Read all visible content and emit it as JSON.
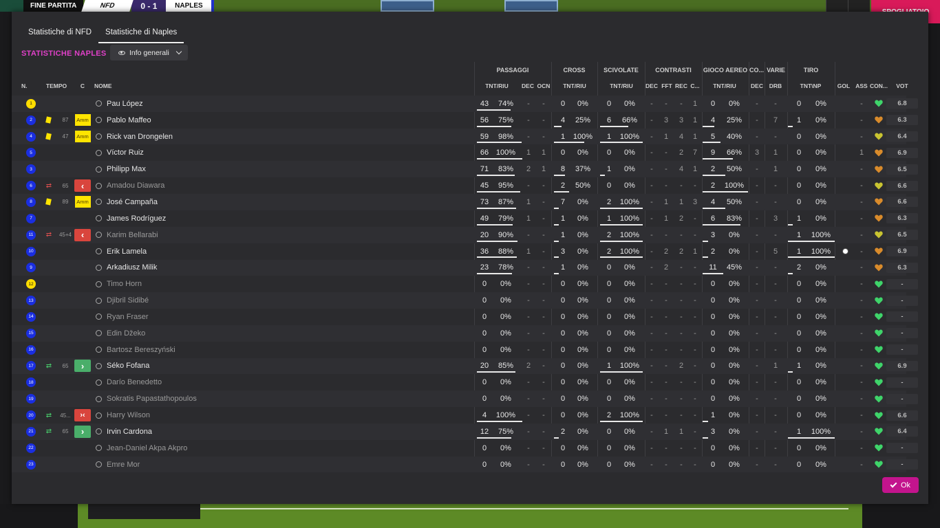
{
  "scorebar": {
    "label": "FINE PARTITA",
    "home": "NFD",
    "score": "0 - 1",
    "away": "NAPLES",
    "right": "SPOGLIATOIO"
  },
  "tabs": [
    "Statistiche di NFD",
    "Statistiche di Naples"
  ],
  "active_tab": 1,
  "section_title": "STATISTICHE NAPLES",
  "view_dropdown": {
    "selected": "Info generali"
  },
  "group_headers": {
    "passaggi": "PASSAGGI",
    "cross": "CROSS",
    "scivolate": "SCIVOLATE",
    "contrasti": "CONTRASTI",
    "gioco_aereo": "GIOCO AEREO",
    "co": "CO...",
    "varie": "VARIE",
    "tiro": "TIRO"
  },
  "col_headers": {
    "n": "N.",
    "tempo": "TEMPO",
    "c": "C",
    "nome": "NOME",
    "pass_tnt": "TNT/RIU",
    "pass_dec": "DEC",
    "pass_ocn": "OCN",
    "cross_tnt": "TNT/RIU",
    "sciv_tnt": "TNT/RIU",
    "con_dec": "DEC",
    "con_fft": "FFT",
    "con_rec": "REC",
    "con_c": "C...",
    "aer_tnt": "TNT/RIU",
    "co_dec": "DEC",
    "var_drb": "DRB",
    "tiro_tnt": "TNT\\NP",
    "gol": "GOL",
    "ass": "ASS",
    "con2": "CON...",
    "vot": "VOT"
  },
  "colors": {
    "accent": "#e040c8",
    "ok_button": "#c3148d",
    "yellow_card": "#ffe400",
    "sub_out": "#d9453d",
    "sub_in": "#4aae6a",
    "heart_green": "#3fd46a",
    "heart_orange": "#d98b2b",
    "heart_yellow": "#c9c431"
  },
  "players": [
    {
      "n": "1",
      "gk": true,
      "card": "",
      "time": "",
      "amm": "",
      "sub": "",
      "arrow": "",
      "name": "Pau López",
      "active": true,
      "pt": "43",
      "pp": "74%",
      "pd": "-",
      "po": "-",
      "ct": "0",
      "cp": "0%",
      "st": "0",
      "sp": "0%",
      "dd": "-",
      "df": "-",
      "dr": "-",
      "dc": "1",
      "at": "0",
      "ap": "0%",
      "cd": "-",
      "drb": "-",
      "tt": "0",
      "tp": "0%",
      "gol": "",
      "ass": "-",
      "heart": "green",
      "vote": "6.8",
      "pbar": 0.74,
      "cbar": 0,
      "sbar": 0,
      "abar": 0,
      "tbar": 0
    },
    {
      "n": "2",
      "gk": false,
      "card": "y",
      "time": "87",
      "amm": "Amm",
      "sub": "",
      "arrow": "",
      "name": "Pablo Maffeo",
      "active": true,
      "pt": "56",
      "pp": "75%",
      "pd": "-",
      "po": "-",
      "ct": "4",
      "cp": "25%",
      "st": "6",
      "sp": "66%",
      "dd": "-",
      "df": "3",
      "dr": "3",
      "dc": "1",
      "at": "4",
      "ap": "25%",
      "cd": "-",
      "drb": "7",
      "tt": "1",
      "tp": "0%",
      "gol": "",
      "ass": "-",
      "heart": "orange",
      "vote": "6.3",
      "pbar": 0.75,
      "cbar": 0.25,
      "sbar": 0.66,
      "abar": 0.25,
      "tbar": 0
    },
    {
      "n": "4",
      "gk": false,
      "card": "y",
      "time": "47",
      "amm": "Amm",
      "sub": "",
      "arrow": "",
      "name": "Rick van Drongelen",
      "active": true,
      "pt": "59",
      "pp": "98%",
      "pd": "-",
      "po": "-",
      "ct": "1",
      "cp": "100%",
      "st": "1",
      "sp": "100%",
      "dd": "-",
      "df": "1",
      "dr": "4",
      "dc": "1",
      "at": "5",
      "ap": "40%",
      "cd": "-",
      "drb": "-",
      "tt": "0",
      "tp": "0%",
      "gol": "",
      "ass": "-",
      "heart": "yellow",
      "vote": "6.4",
      "pbar": 0.98,
      "cbar": 1,
      "sbar": 1,
      "abar": 0.4,
      "tbar": 0
    },
    {
      "n": "5",
      "gk": false,
      "card": "",
      "time": "",
      "amm": "",
      "sub": "",
      "arrow": "",
      "name": "Víctor Ruiz",
      "active": true,
      "pt": "66",
      "pp": "100%",
      "pd": "1",
      "po": "1",
      "ct": "0",
      "cp": "0%",
      "st": "0",
      "sp": "0%",
      "dd": "-",
      "df": "-",
      "dr": "2",
      "dc": "7",
      "at": "9",
      "ap": "66%",
      "cd": "3",
      "drb": "1",
      "tt": "0",
      "tp": "0%",
      "gol": "",
      "ass": "1",
      "heart": "orange",
      "vote": "6.9",
      "pbar": 1,
      "cbar": 0,
      "sbar": 0,
      "abar": 0.66,
      "tbar": 0
    },
    {
      "n": "3",
      "gk": false,
      "card": "",
      "time": "",
      "amm": "",
      "sub": "",
      "arrow": "",
      "name": "Philipp Max",
      "active": true,
      "pt": "71",
      "pp": "83%",
      "pd": "2",
      "po": "1",
      "ct": "8",
      "cp": "37%",
      "st": "1",
      "sp": "0%",
      "dd": "-",
      "df": "-",
      "dr": "4",
      "dc": "1",
      "at": "2",
      "ap": "50%",
      "cd": "-",
      "drb": "1",
      "tt": "0",
      "tp": "0%",
      "gol": "",
      "ass": "-",
      "heart": "orange",
      "vote": "6.5",
      "pbar": 0.83,
      "cbar": 0.37,
      "sbar": 0,
      "abar": 0.5,
      "tbar": 0
    },
    {
      "n": "6",
      "gk": false,
      "card": "",
      "time": "65",
      "amm": "",
      "sub": "red",
      "arrow": "out",
      "name": "Amadou Diawara",
      "active": false,
      "pt": "45",
      "pp": "95%",
      "pd": "-",
      "po": "-",
      "ct": "2",
      "cp": "50%",
      "st": "0",
      "sp": "0%",
      "dd": "-",
      "df": "-",
      "dr": "-",
      "dc": "-",
      "at": "2",
      "ap": "100%",
      "cd": "-",
      "drb": "-",
      "tt": "0",
      "tp": "0%",
      "gol": "",
      "ass": "-",
      "heart": "yellow",
      "vote": "6.6",
      "pbar": 0.95,
      "cbar": 0.5,
      "sbar": 0,
      "abar": 1,
      "tbar": 0
    },
    {
      "n": "8",
      "gk": false,
      "card": "y",
      "time": "89",
      "amm": "Amm",
      "sub": "",
      "arrow": "",
      "name": "José Campaña",
      "active": true,
      "pt": "73",
      "pp": "87%",
      "pd": "1",
      "po": "-",
      "ct": "7",
      "cp": "0%",
      "st": "2",
      "sp": "100%",
      "dd": "-",
      "df": "1",
      "dr": "1",
      "dc": "3",
      "at": "4",
      "ap": "50%",
      "cd": "-",
      "drb": "-",
      "tt": "0",
      "tp": "0%",
      "gol": "",
      "ass": "-",
      "heart": "orange",
      "vote": "6.6",
      "pbar": 0.87,
      "cbar": 0,
      "sbar": 1,
      "abar": 0.5,
      "tbar": 0
    },
    {
      "n": "7",
      "gk": false,
      "card": "",
      "time": "",
      "amm": "",
      "sub": "",
      "arrow": "",
      "name": "James Rodríguez",
      "active": true,
      "pt": "49",
      "pp": "79%",
      "pd": "1",
      "po": "-",
      "ct": "1",
      "cp": "0%",
      "st": "1",
      "sp": "100%",
      "dd": "-",
      "df": "1",
      "dr": "2",
      "dc": "-",
      "at": "6",
      "ap": "83%",
      "cd": "-",
      "drb": "3",
      "tt": "1",
      "tp": "0%",
      "gol": "",
      "ass": "-",
      "heart": "orange",
      "vote": "6.3",
      "pbar": 0.79,
      "cbar": 0,
      "sbar": 1,
      "abar": 0.83,
      "tbar": 0
    },
    {
      "n": "11",
      "gk": false,
      "card": "",
      "time": "45+4",
      "amm": "",
      "sub": "red",
      "arrow": "out",
      "name": "Karim Bellarabi",
      "active": false,
      "pt": "20",
      "pp": "90%",
      "pd": "-",
      "po": "-",
      "ct": "1",
      "cp": "0%",
      "st": "2",
      "sp": "100%",
      "dd": "-",
      "df": "-",
      "dr": "-",
      "dc": "-",
      "at": "3",
      "ap": "0%",
      "cd": "-",
      "drb": "-",
      "tt": "1",
      "tp": "100%",
      "gol": "",
      "ass": "-",
      "heart": "yellow",
      "vote": "6.5",
      "pbar": 0.9,
      "cbar": 0,
      "sbar": 1,
      "abar": 0,
      "tbar": 1
    },
    {
      "n": "10",
      "gk": false,
      "card": "",
      "time": "",
      "amm": "",
      "sub": "",
      "arrow": "",
      "name": "Erik Lamela",
      "active": true,
      "pt": "36",
      "pp": "88%",
      "pd": "1",
      "po": "-",
      "ct": "3",
      "cp": "0%",
      "st": "2",
      "sp": "100%",
      "dd": "-",
      "df": "2",
      "dr": "2",
      "dc": "1",
      "at": "2",
      "ap": "0%",
      "cd": "-",
      "drb": "5",
      "tt": "1",
      "tp": "100%",
      "gol": "ball",
      "ass": "-",
      "heart": "orange",
      "vote": "6.9",
      "pbar": 0.88,
      "cbar": 0,
      "sbar": 1,
      "abar": 0,
      "tbar": 1
    },
    {
      "n": "9",
      "gk": false,
      "card": "",
      "time": "",
      "amm": "",
      "sub": "",
      "arrow": "",
      "name": "Arkadiusz Milik",
      "active": true,
      "pt": "23",
      "pp": "78%",
      "pd": "-",
      "po": "-",
      "ct": "1",
      "cp": "0%",
      "st": "0",
      "sp": "0%",
      "dd": "-",
      "df": "2",
      "dr": "-",
      "dc": "-",
      "at": "11",
      "ap": "45%",
      "cd": "-",
      "drb": "-",
      "tt": "2",
      "tp": "0%",
      "gol": "",
      "ass": "-",
      "heart": "orange",
      "vote": "6.3",
      "pbar": 0.78,
      "cbar": 0,
      "sbar": 0,
      "abar": 0.45,
      "tbar": 0
    },
    {
      "n": "12",
      "gk": true,
      "card": "",
      "time": "",
      "amm": "",
      "sub": "",
      "arrow": "",
      "name": "Timo Horn",
      "active": false,
      "pt": "0",
      "pp": "0%",
      "pd": "-",
      "po": "-",
      "ct": "0",
      "cp": "0%",
      "st": "0",
      "sp": "0%",
      "dd": "-",
      "df": "-",
      "dr": "-",
      "dc": "-",
      "at": "0",
      "ap": "0%",
      "cd": "-",
      "drb": "-",
      "tt": "0",
      "tp": "0%",
      "gol": "",
      "ass": "-",
      "heart": "green",
      "vote": "-",
      "pbar": 0,
      "cbar": 0,
      "sbar": 0,
      "abar": 0,
      "tbar": 0
    },
    {
      "n": "13",
      "gk": false,
      "card": "",
      "time": "",
      "amm": "",
      "sub": "",
      "arrow": "",
      "name": "Djibril Sidibé",
      "active": false,
      "pt": "0",
      "pp": "0%",
      "pd": "-",
      "po": "-",
      "ct": "0",
      "cp": "0%",
      "st": "0",
      "sp": "0%",
      "dd": "-",
      "df": "-",
      "dr": "-",
      "dc": "-",
      "at": "0",
      "ap": "0%",
      "cd": "-",
      "drb": "-",
      "tt": "0",
      "tp": "0%",
      "gol": "",
      "ass": "-",
      "heart": "green",
      "vote": "-",
      "pbar": 0,
      "cbar": 0,
      "sbar": 0,
      "abar": 0,
      "tbar": 0
    },
    {
      "n": "14",
      "gk": false,
      "card": "",
      "time": "",
      "amm": "",
      "sub": "",
      "arrow": "",
      "name": "Ryan Fraser",
      "active": false,
      "pt": "0",
      "pp": "0%",
      "pd": "-",
      "po": "-",
      "ct": "0",
      "cp": "0%",
      "st": "0",
      "sp": "0%",
      "dd": "-",
      "df": "-",
      "dr": "-",
      "dc": "-",
      "at": "0",
      "ap": "0%",
      "cd": "-",
      "drb": "-",
      "tt": "0",
      "tp": "0%",
      "gol": "",
      "ass": "-",
      "heart": "green",
      "vote": "-",
      "pbar": 0,
      "cbar": 0,
      "sbar": 0,
      "abar": 0,
      "tbar": 0
    },
    {
      "n": "15",
      "gk": false,
      "card": "",
      "time": "",
      "amm": "",
      "sub": "",
      "arrow": "",
      "name": "Edin Džeko",
      "active": false,
      "pt": "0",
      "pp": "0%",
      "pd": "-",
      "po": "-",
      "ct": "0",
      "cp": "0%",
      "st": "0",
      "sp": "0%",
      "dd": "-",
      "df": "-",
      "dr": "-",
      "dc": "-",
      "at": "0",
      "ap": "0%",
      "cd": "-",
      "drb": "-",
      "tt": "0",
      "tp": "0%",
      "gol": "",
      "ass": "-",
      "heart": "green",
      "vote": "-",
      "pbar": 0,
      "cbar": 0,
      "sbar": 0,
      "abar": 0,
      "tbar": 0
    },
    {
      "n": "16",
      "gk": false,
      "card": "",
      "time": "",
      "amm": "",
      "sub": "",
      "arrow": "",
      "name": "Bartosz Bereszyński",
      "active": false,
      "pt": "0",
      "pp": "0%",
      "pd": "-",
      "po": "-",
      "ct": "0",
      "cp": "0%",
      "st": "0",
      "sp": "0%",
      "dd": "-",
      "df": "-",
      "dr": "-",
      "dc": "-",
      "at": "0",
      "ap": "0%",
      "cd": "-",
      "drb": "-",
      "tt": "0",
      "tp": "0%",
      "gol": "",
      "ass": "-",
      "heart": "green",
      "vote": "-",
      "pbar": 0,
      "cbar": 0,
      "sbar": 0,
      "abar": 0,
      "tbar": 0
    },
    {
      "n": "17",
      "gk": false,
      "card": "",
      "time": "65",
      "amm": "",
      "sub": "green",
      "arrow": "in",
      "name": "Séko Fofana",
      "active": true,
      "pt": "20",
      "pp": "85%",
      "pd": "2",
      "po": "-",
      "ct": "0",
      "cp": "0%",
      "st": "1",
      "sp": "100%",
      "dd": "-",
      "df": "-",
      "dr": "2",
      "dc": "-",
      "at": "0",
      "ap": "0%",
      "cd": "-",
      "drb": "1",
      "tt": "1",
      "tp": "0%",
      "gol": "",
      "ass": "-",
      "heart": "green",
      "vote": "6.9",
      "pbar": 0.85,
      "cbar": 0,
      "sbar": 1,
      "abar": 0,
      "tbar": 0
    },
    {
      "n": "18",
      "gk": false,
      "card": "",
      "time": "",
      "amm": "",
      "sub": "",
      "arrow": "",
      "name": "Darío Benedetto",
      "active": false,
      "pt": "0",
      "pp": "0%",
      "pd": "-",
      "po": "-",
      "ct": "0",
      "cp": "0%",
      "st": "0",
      "sp": "0%",
      "dd": "-",
      "df": "-",
      "dr": "-",
      "dc": "-",
      "at": "0",
      "ap": "0%",
      "cd": "-",
      "drb": "-",
      "tt": "0",
      "tp": "0%",
      "gol": "",
      "ass": "-",
      "heart": "green",
      "vote": "-",
      "pbar": 0,
      "cbar": 0,
      "sbar": 0,
      "abar": 0,
      "tbar": 0
    },
    {
      "n": "19",
      "gk": false,
      "card": "",
      "time": "",
      "amm": "",
      "sub": "",
      "arrow": "",
      "name": "Sokratis Papastathopoulos",
      "active": false,
      "pt": "0",
      "pp": "0%",
      "pd": "-",
      "po": "-",
      "ct": "0",
      "cp": "0%",
      "st": "0",
      "sp": "0%",
      "dd": "-",
      "df": "-",
      "dr": "-",
      "dc": "-",
      "at": "0",
      "ap": "0%",
      "cd": "-",
      "drb": "-",
      "tt": "0",
      "tp": "0%",
      "gol": "",
      "ass": "-",
      "heart": "green",
      "vote": "-",
      "pbar": 0,
      "cbar": 0,
      "sbar": 0,
      "abar": 0,
      "tbar": 0
    },
    {
      "n": "20",
      "gk": false,
      "card": "",
      "time": "45...",
      "amm": "",
      "sub": "green",
      "arrow": "both",
      "name": "Harry Wilson",
      "active": false,
      "pt": "4",
      "pp": "100%",
      "pd": "-",
      "po": "-",
      "ct": "0",
      "cp": "0%",
      "st": "2",
      "sp": "100%",
      "dd": "-",
      "df": "-",
      "dr": "-",
      "dc": "-",
      "at": "1",
      "ap": "0%",
      "cd": "-",
      "drb": "-",
      "tt": "0",
      "tp": "0%",
      "gol": "",
      "ass": "-",
      "heart": "green",
      "vote": "6.6",
      "pbar": 1,
      "cbar": 0,
      "sbar": 1,
      "abar": 0,
      "tbar": 0
    },
    {
      "n": "21",
      "gk": false,
      "card": "",
      "time": "65",
      "amm": "",
      "sub": "green",
      "arrow": "in",
      "name": "Irvin Cardona",
      "active": true,
      "pt": "12",
      "pp": "75%",
      "pd": "-",
      "po": "-",
      "ct": "2",
      "cp": "0%",
      "st": "0",
      "sp": "0%",
      "dd": "-",
      "df": "1",
      "dr": "1",
      "dc": "-",
      "at": "3",
      "ap": "0%",
      "cd": "-",
      "drb": "-",
      "tt": "1",
      "tp": "100%",
      "gol": "",
      "ass": "-",
      "heart": "green",
      "vote": "6.4",
      "pbar": 0.75,
      "cbar": 0,
      "sbar": 0,
      "abar": 0,
      "tbar": 1
    },
    {
      "n": "22",
      "gk": false,
      "card": "",
      "time": "",
      "amm": "",
      "sub": "",
      "arrow": "",
      "name": "Jean-Daniel Akpa Akpro",
      "active": false,
      "pt": "0",
      "pp": "0%",
      "pd": "-",
      "po": "-",
      "ct": "0",
      "cp": "0%",
      "st": "0",
      "sp": "0%",
      "dd": "-",
      "df": "-",
      "dr": "-",
      "dc": "-",
      "at": "0",
      "ap": "0%",
      "cd": "-",
      "drb": "-",
      "tt": "0",
      "tp": "0%",
      "gol": "",
      "ass": "-",
      "heart": "green",
      "vote": "-",
      "pbar": 0,
      "cbar": 0,
      "sbar": 0,
      "abar": 0,
      "tbar": 0
    },
    {
      "n": "23",
      "gk": false,
      "card": "",
      "time": "",
      "amm": "",
      "sub": "",
      "arrow": "",
      "name": "Emre Mor",
      "active": false,
      "pt": "0",
      "pp": "0%",
      "pd": "-",
      "po": "-",
      "ct": "0",
      "cp": "0%",
      "st": "0",
      "sp": "0%",
      "dd": "-",
      "df": "-",
      "dr": "-",
      "dc": "-",
      "at": "0",
      "ap": "0%",
      "cd": "-",
      "drb": "-",
      "tt": "0",
      "tp": "0%",
      "gol": "",
      "ass": "-",
      "heart": "green",
      "vote": "-",
      "pbar": 0,
      "cbar": 0,
      "sbar": 0,
      "abar": 0,
      "tbar": 0
    }
  ],
  "ok_button": "Ok"
}
